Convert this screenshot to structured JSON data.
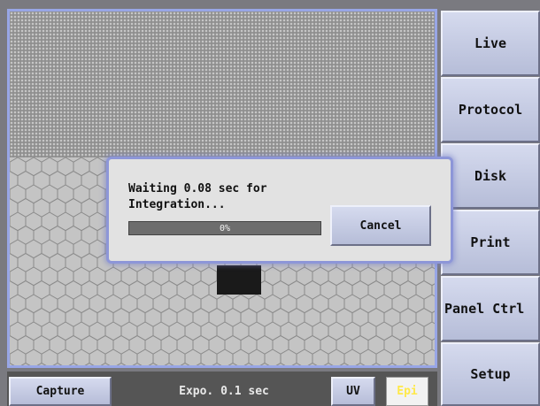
{
  "side_menu": {
    "items": [
      {
        "label": "Live"
      },
      {
        "label": "Protocol"
      },
      {
        "label": "Disk"
      },
      {
        "label": "Print"
      },
      {
        "label": "Panel Ctrl"
      },
      {
        "label": "Setup"
      }
    ]
  },
  "bottom_bar": {
    "capture_label": "Capture",
    "exposure_text": "Expo. 0.1 sec",
    "uv_label": "UV",
    "epi_label": "Epi"
  },
  "dialog": {
    "message_line1": "Waiting 0.08 sec for",
    "message_line2": "Integration...",
    "progress_percent": 0,
    "progress_text": "0%",
    "cancel_label": "Cancel"
  },
  "colors": {
    "accent_border": "#8d96d8",
    "button_face": "#c6cce4",
    "epi_text": "#ffe94a"
  }
}
